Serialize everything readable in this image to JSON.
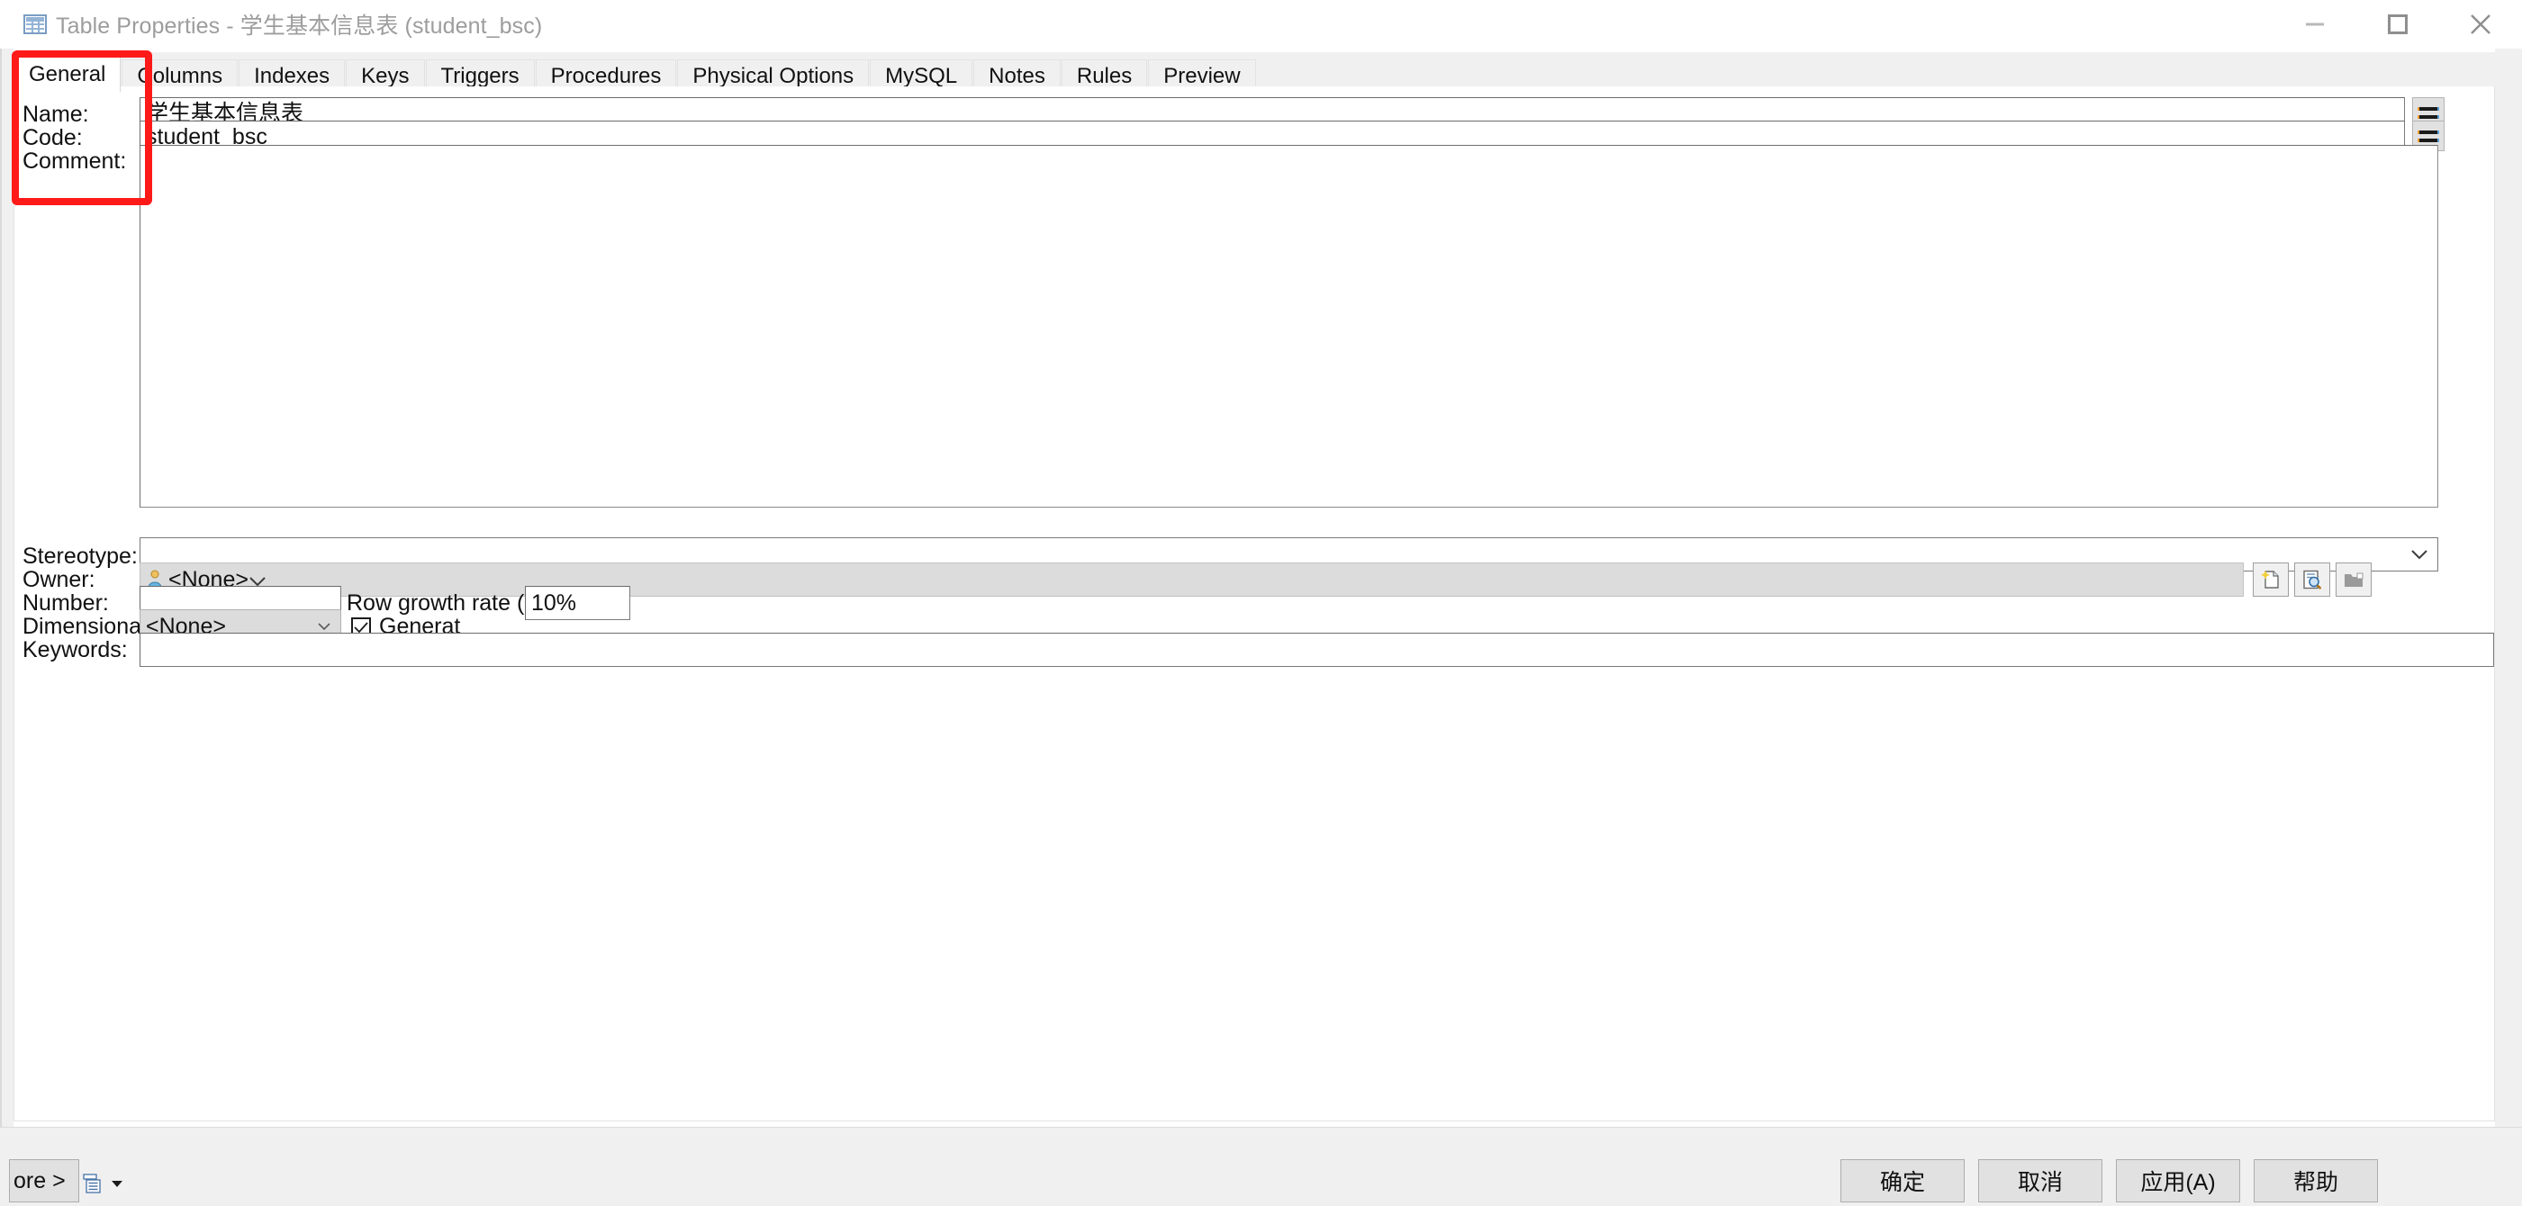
{
  "window": {
    "title": "Table Properties - 学生基本信息表 (student_bsc)",
    "icon": "table-icon",
    "controls": {
      "minimize": "minimize-icon",
      "maximize": "maximize-icon",
      "close": "close-icon"
    }
  },
  "tabs": [
    {
      "label": "General",
      "active": true
    },
    {
      "label": "Columns",
      "active": false
    },
    {
      "label": "Indexes",
      "active": false
    },
    {
      "label": "Keys",
      "active": false
    },
    {
      "label": "Triggers",
      "active": false
    },
    {
      "label": "Procedures",
      "active": false
    },
    {
      "label": "Physical Options",
      "active": false
    },
    {
      "label": "MySQL",
      "active": false
    },
    {
      "label": "Notes",
      "active": false
    },
    {
      "label": "Rules",
      "active": false
    },
    {
      "label": "Preview",
      "active": false
    }
  ],
  "general": {
    "name_label": "Name:",
    "name_value": "学生基本信息表",
    "code_label": "Code:",
    "code_value": "student_bsc",
    "comment_label": "Comment:",
    "comment_value": "",
    "stereotype_label": "Stereotype:",
    "stereotype_value": "",
    "owner_label": "Owner:",
    "owner_value": "<None>",
    "owner_icon": "user-icon",
    "number_label": "Number:",
    "number_value": "",
    "row_growth_label": "Row growth rate (per year):",
    "row_growth_value": "10%",
    "dimensional_label": "Dimensional type:",
    "dimensional_value": "<None>",
    "generate_label": "Generat",
    "generate_checked": true,
    "keywords_label": "Keywords:",
    "keywords_value": ""
  },
  "owner_buttons": [
    {
      "name": "create-object-button",
      "icon": "new-page-icon"
    },
    {
      "name": "object-properties-button",
      "icon": "magnifier-page-icon"
    },
    {
      "name": "select-object-button",
      "icon": "folder-icon"
    }
  ],
  "field_buttons": {
    "name_equal": "equal-button",
    "code_equal": "equal-button"
  },
  "footer": {
    "more_label": "ore >",
    "more_icon": "list-icon",
    "more_dropdown_icon": "caret-down-icon",
    "buttons": [
      {
        "name": "ok-button",
        "label": "确定"
      },
      {
        "name": "cancel-button",
        "label": "取消"
      },
      {
        "name": "apply-button",
        "label": "应用(A)"
      },
      {
        "name": "help-button",
        "label": "帮助"
      }
    ]
  },
  "annotation": {
    "color": "#ff1a1a",
    "shape": "rounded-rectangle"
  },
  "colors": {
    "title_text": "#9d9d9d",
    "page_bg": "#ffffff",
    "chrome_bg": "#f0f0f0",
    "disabled_field": "#dcdcdc",
    "annotation": "#ff1a1a"
  }
}
